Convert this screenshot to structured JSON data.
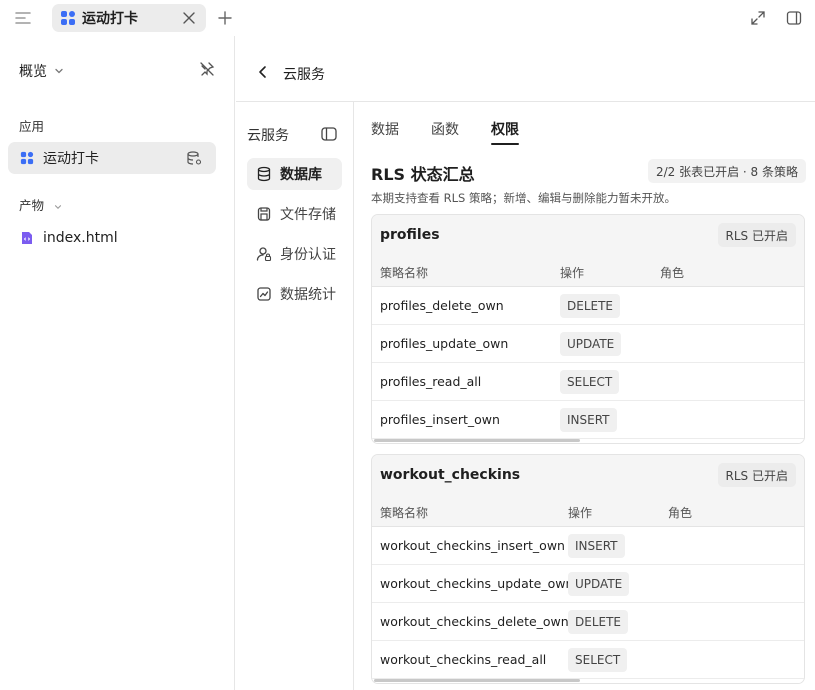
{
  "tab": {
    "label": "运动打卡"
  },
  "sidebar": {
    "overview_label": "概览",
    "apps_section": "应用",
    "app_item": "运动打卡",
    "artifacts_section": "产物",
    "artifact_item": "index.html"
  },
  "header": {
    "title": "云服务"
  },
  "service_nav": {
    "title": "云服务",
    "items": [
      {
        "label": "数据库",
        "icon": "database-icon",
        "active": true
      },
      {
        "label": "文件存储",
        "icon": "storage-icon",
        "active": false
      },
      {
        "label": "身份认证",
        "icon": "user-auth-icon",
        "active": false
      },
      {
        "label": "数据统计",
        "icon": "analytics-icon",
        "active": false
      }
    ]
  },
  "tabs": [
    {
      "label": "数据",
      "active": false
    },
    {
      "label": "函数",
      "active": false
    },
    {
      "label": "权限",
      "active": true
    }
  ],
  "rls": {
    "title": "RLS 状态汇总",
    "badge": "2/2 张表已开启 · 8 条策略",
    "description": "本期支持查看 RLS 策略；新增、编辑与删除能力暂未开放。"
  },
  "tables": [
    {
      "name": "profiles",
      "badge": "RLS 已开启",
      "columns": [
        "策略名称",
        "操作",
        "角色"
      ],
      "rows": [
        {
          "name": "profiles_delete_own",
          "op": "DELETE"
        },
        {
          "name": "profiles_update_own",
          "op": "UPDATE"
        },
        {
          "name": "profiles_read_all",
          "op": "SELECT"
        },
        {
          "name": "profiles_insert_own",
          "op": "INSERT"
        }
      ]
    },
    {
      "name": "workout_checkins",
      "badge": "RLS 已开启",
      "columns": [
        "策略名称",
        "操作",
        "角色"
      ],
      "rows": [
        {
          "name": "workout_checkins_insert_own",
          "op": "INSERT"
        },
        {
          "name": "workout_checkins_update_own",
          "op": "UPDATE"
        },
        {
          "name": "workout_checkins_delete_own",
          "op": "DELETE"
        },
        {
          "name": "workout_checkins_read_all",
          "op": "SELECT"
        }
      ]
    }
  ],
  "colors": {
    "accent_blue": "#3b6ef5",
    "accent_purple": "#7b5cf0"
  }
}
